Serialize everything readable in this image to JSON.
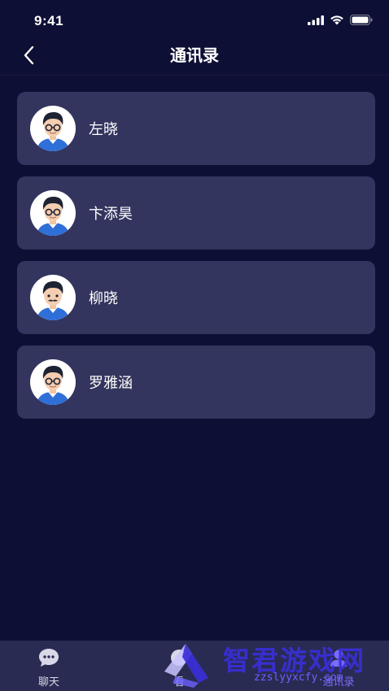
{
  "status_bar": {
    "time": "9:41",
    "icons": [
      "signal-icon",
      "wifi-icon",
      "battery-icon"
    ]
  },
  "nav": {
    "title": "通讯录",
    "back_icon": "chevron-left-icon"
  },
  "contacts": [
    {
      "name": "左晓",
      "avatar": "male-avatar-glasses"
    },
    {
      "name": "卞添昊",
      "avatar": "male-avatar-glasses"
    },
    {
      "name": "柳晓",
      "avatar": "male-avatar-mustache"
    },
    {
      "name": "罗雅涵",
      "avatar": "male-avatar-glasses"
    }
  ],
  "tab_bar": {
    "tabs": [
      {
        "label": "聊天",
        "icon": "chat-bubble-icon",
        "active": false
      },
      {
        "label": "看",
        "icon": "tab-icon",
        "active": false
      },
      {
        "label": "通讯录",
        "icon": "contacts-icon",
        "active": true
      }
    ]
  },
  "watermark": {
    "title": "智君游戏网",
    "subtitle": "zzslyyxcfy.com"
  },
  "colors": {
    "background": "#0e0f35",
    "card": "#33355e",
    "tab_bar": "#2a2b52",
    "accent": "#7b6bff"
  }
}
